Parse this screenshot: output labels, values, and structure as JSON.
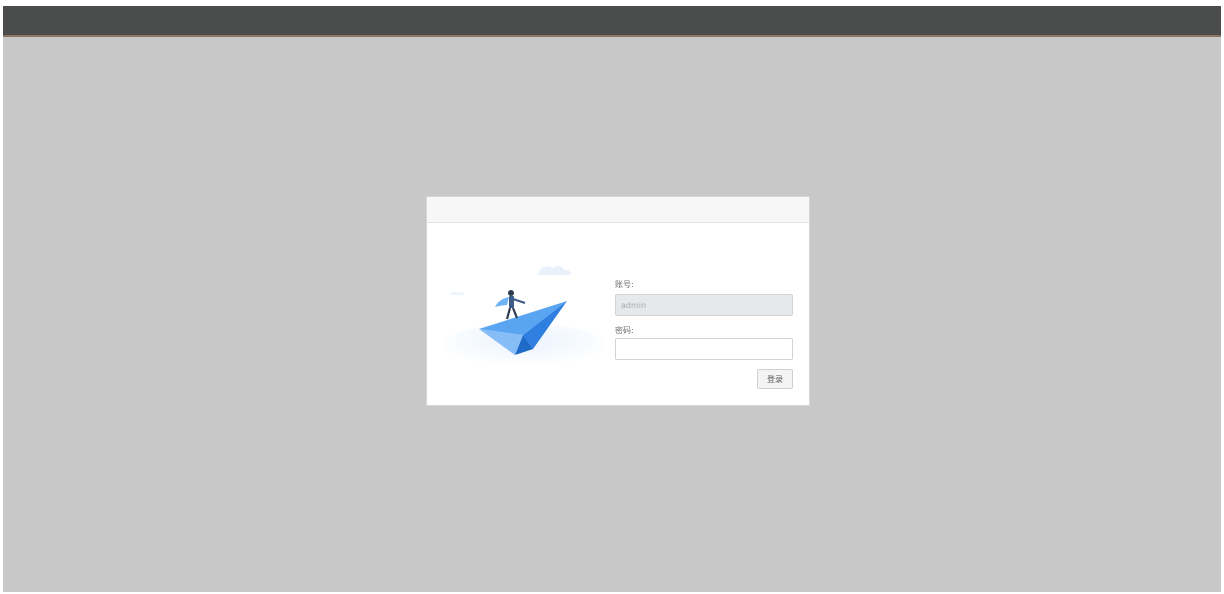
{
  "login": {
    "account_label": "账号:",
    "account_value": "admin",
    "password_label": "密码:",
    "password_value": "",
    "submit_label": "登录"
  },
  "colors": {
    "topbar": "#4b4c4c",
    "topbar_accent": "#8a7566",
    "backdrop": "#c8c8c8",
    "dialog_header": "#f7f7f7",
    "illustration_blue": "#3f8ee8"
  },
  "icons": {
    "illustration": "paper-plane-rider-illustration"
  }
}
